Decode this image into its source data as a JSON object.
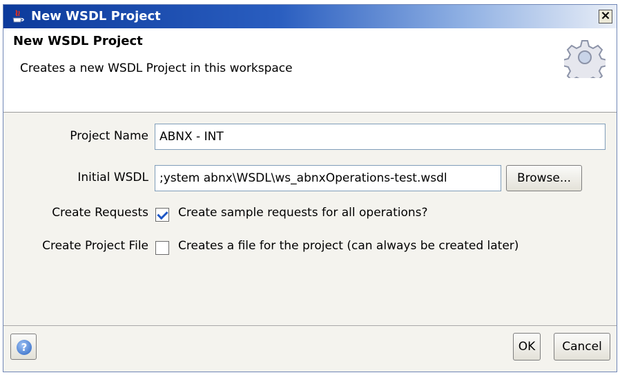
{
  "window": {
    "title": "New WSDL Project",
    "close_label": "×"
  },
  "header": {
    "title": "New WSDL Project",
    "description": "Creates a new WSDL Project in this workspace",
    "icon": "gear-icon"
  },
  "form": {
    "project_name": {
      "label": "Project Name",
      "value": "ABNX - INT"
    },
    "initial_wsdl": {
      "label": "Initial WSDL",
      "value": ";ystem abnx\\WSDL\\ws_abnxOperations-test.wsdl",
      "browse_label": "Browse..."
    },
    "create_requests": {
      "label": "Create Requests",
      "checkbox_label": "Create sample requests for all operations?",
      "checked": true
    },
    "create_project_file": {
      "label": "Create Project File",
      "checkbox_label": "Creates a file for the project (can always be created later)",
      "checked": false
    }
  },
  "footer": {
    "help_label": "?",
    "ok_label": "OK",
    "cancel_label": "Cancel"
  }
}
